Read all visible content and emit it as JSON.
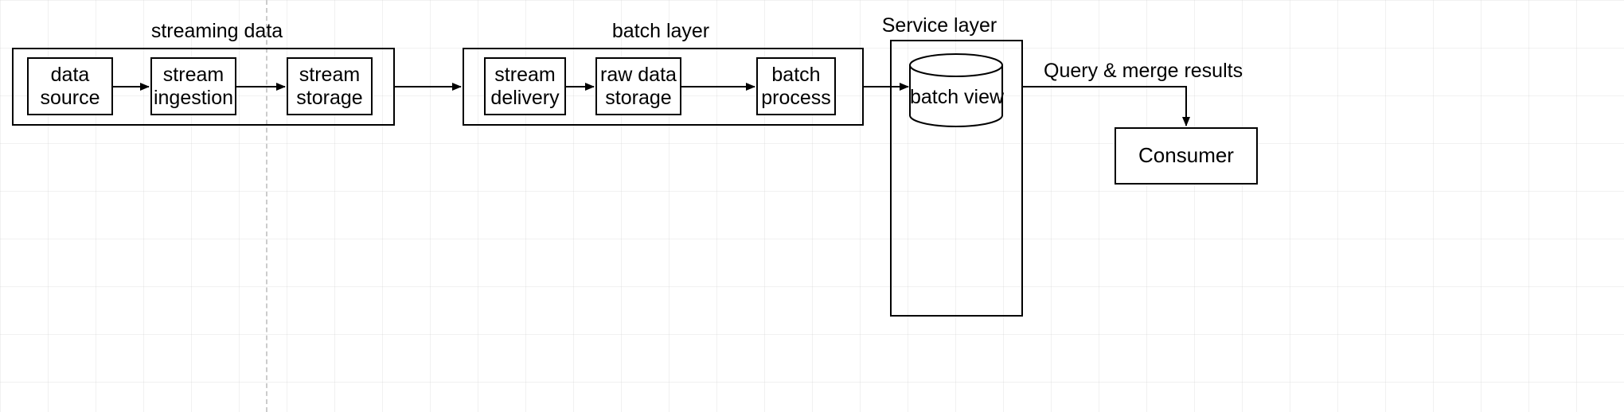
{
  "groups": {
    "streaming": {
      "label": "streaming data"
    },
    "batch": {
      "label": "batch layer"
    },
    "service": {
      "label": "Service layer"
    }
  },
  "nodes": {
    "data_source": "data\nsource",
    "stream_ingestion": "stream\ningestion",
    "stream_storage": "stream\nstorage",
    "stream_delivery": "stream\ndelivery",
    "raw_data_storage": "raw data\nstorage",
    "batch_process": "batch\nprocess",
    "batch_view": "batch view",
    "consumer": "Consumer"
  },
  "arrows": {
    "query_merge": "Query & merge results"
  }
}
